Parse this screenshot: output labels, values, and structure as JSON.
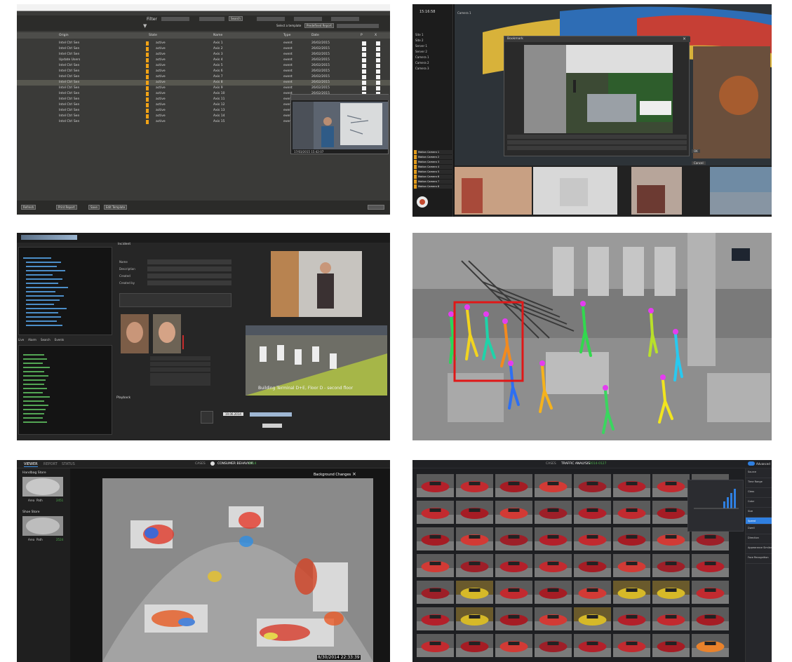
{
  "p1": {
    "filter": {
      "label": "Filter",
      "search_btn": "Search",
      "select_template": "Select a template",
      "template_value": "Predefined Report"
    },
    "columns": [
      "Origin",
      "State",
      "Name",
      "Type",
      "Date",
      "P",
      "X"
    ],
    "rows": [
      {
        "origin": "Intel Ctrl Sen",
        "state": "active",
        "name": "Axis 1",
        "type": "event",
        "date": "26/02/2015"
      },
      {
        "origin": "Intel Ctrl Sen",
        "state": "active",
        "name": "Axis 2",
        "type": "event",
        "date": "26/02/2015"
      },
      {
        "origin": "Intel Ctrl Sen",
        "state": "active",
        "name": "Axis 3",
        "type": "event",
        "date": "26/02/2015"
      },
      {
        "origin": "Update Users",
        "state": "active",
        "name": "Axis 4",
        "type": "event",
        "date": "26/02/2015"
      },
      {
        "origin": "Intel Ctrl Sen",
        "state": "active",
        "name": "Axis 5",
        "type": "event",
        "date": "26/02/2015"
      },
      {
        "origin": "Intel Ctrl Sen",
        "state": "active",
        "name": "Axis 6",
        "type": "event",
        "date": "26/02/2015"
      },
      {
        "origin": "Intel Ctrl Sen",
        "state": "active",
        "name": "Axis 7",
        "type": "event",
        "date": "26/02/2015"
      },
      {
        "origin": "Intel Ctrl Sen",
        "state": "active",
        "name": "Axis 8",
        "type": "event",
        "date": "26/02/2015"
      },
      {
        "origin": "Intel Ctrl Sen",
        "state": "active",
        "name": "Axis 9",
        "type": "event",
        "date": "26/02/2015"
      },
      {
        "origin": "Intel Ctrl Sen",
        "state": "active",
        "name": "Axis 10",
        "type": "event",
        "date": "26/02/2015"
      },
      {
        "origin": "Intel Ctrl Sen",
        "state": "active",
        "name": "Axis 11",
        "type": "event",
        "date": "26/02/2015"
      },
      {
        "origin": "Intel Ctrl Sen",
        "state": "active",
        "name": "Axis 12",
        "type": "event",
        "date": "26/02/2015"
      },
      {
        "origin": "Intel Ctrl Sen",
        "state": "active",
        "name": "Axis 13",
        "type": "event",
        "date": "26/02/2015"
      },
      {
        "origin": "Intel Ctrl Sen",
        "state": "active",
        "name": "Axis 14",
        "type": "event",
        "date": "26/02/2015"
      },
      {
        "origin": "Intel Ctrl Sen",
        "state": "active",
        "name": "Axis 15",
        "type": "event",
        "date": "26/02/2015"
      }
    ],
    "preview_time": "17/03/2015 15:42:07",
    "footer_buttons": [
      "Refresh",
      "Print Report",
      "Save",
      "Edit Template"
    ]
  },
  "p2": {
    "clock": "15:16:58",
    "camera_label": "Camera 1",
    "dialog_title": "Bookmark",
    "tree": [
      "Site 1",
      "Site 2",
      "Server 1",
      "Server 2",
      "Camera 1",
      "Camera 2",
      "Camera 3"
    ],
    "alarm_rows": [
      "Motion Camera 1",
      "Motion Camera 2",
      "Motion Camera 3",
      "Motion Camera 4",
      "Motion Camera 5",
      "Motion Camera 6",
      "Motion Camera 7",
      "Motion Camera 8"
    ],
    "ok": "OK",
    "cancel": "Cancel"
  },
  "p3": {
    "section_title": "Incident",
    "tabs": [
      "Live",
      "Alarm",
      "Search",
      "Events"
    ],
    "fields": [
      "Name",
      "Description",
      "Created",
      "Created by"
    ],
    "caption": "Building Terminal D+E, Floor D - second floor",
    "date_value": "19.06.2014",
    "playback_label": "Playback"
  },
  "p5": {
    "tabs": [
      "VIEWER",
      "REPORT",
      "STATUS"
    ],
    "breadcrumb_cases": "CASES",
    "breadcrumb_title": "CONSUMER BEHAVIOR",
    "breadcrumb_badge": "2014",
    "stores": [
      {
        "name": "Handbag Store",
        "area": "Area",
        "path": "Path",
        "count": "2451"
      },
      {
        "name": "Shoe Store",
        "area": "Area",
        "path": "Path",
        "count": "2524"
      }
    ],
    "overlay_title": "Background Changes",
    "timestamp": "8/30/2014 22:33:39"
  },
  "p6": {
    "breadcrumb_cases": "CASES",
    "breadcrumb_title": "TRAFFIC ANALYSIS",
    "breadcrumb_badge": "2014-0127",
    "toggle_label": "Advanced",
    "filters": [
      "Source",
      "Time Range",
      "Class",
      "Color",
      "Size",
      "Speed",
      "Dwell",
      "Direction",
      "Appearance Similarity",
      "Face Recognition"
    ],
    "color_bg": "#1e1f22",
    "accent": "#2f7fe0"
  }
}
